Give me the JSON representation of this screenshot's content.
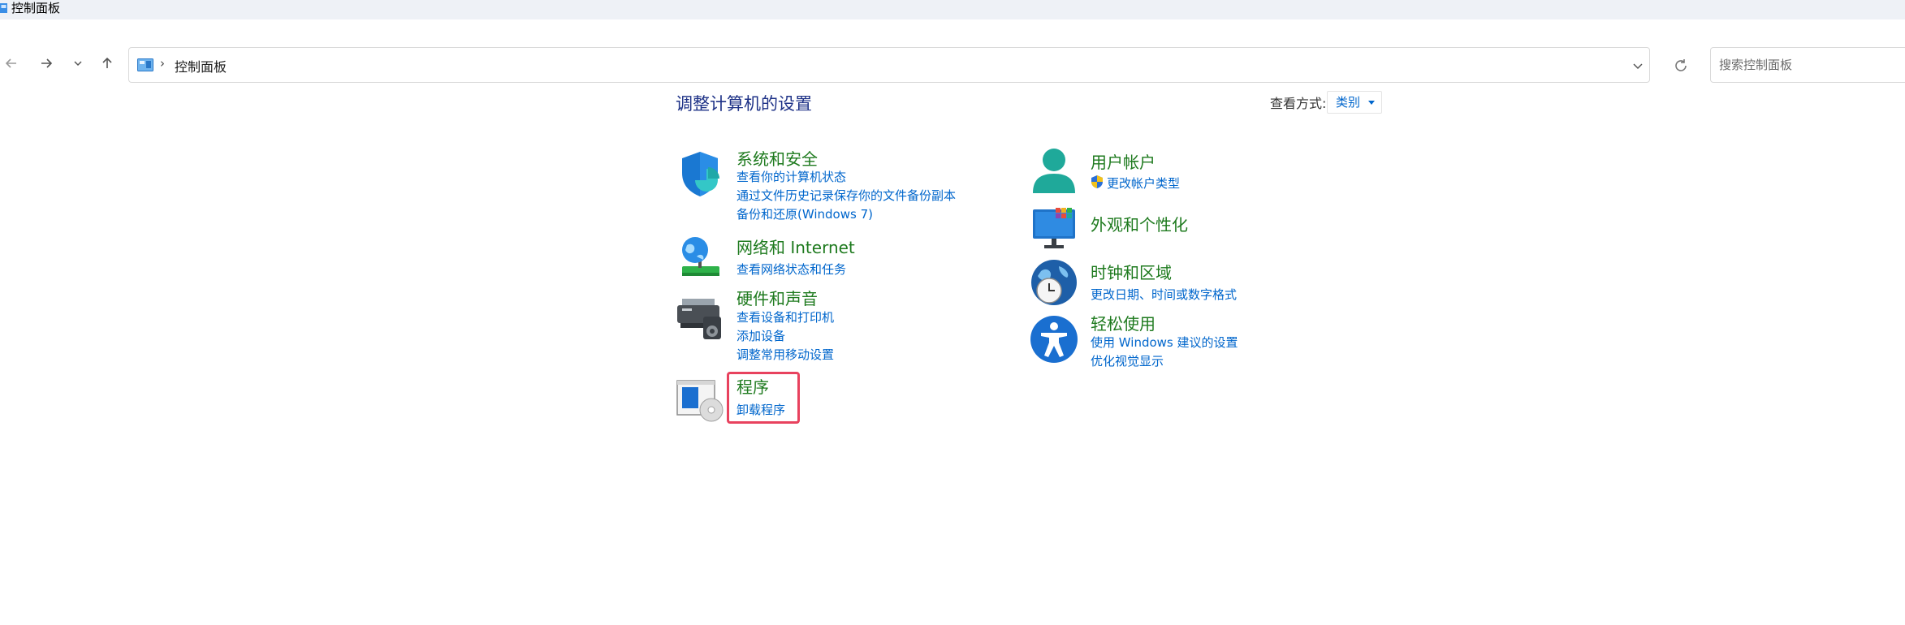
{
  "window": {
    "title": "控制面板"
  },
  "address_bar": {
    "crumb": "控制面板",
    "separator": "›"
  },
  "search": {
    "placeholder": "搜索控制面板"
  },
  "page": {
    "heading": "调整计算机的设置",
    "view_by_label": "查看方式:",
    "view_by_value": "类别"
  },
  "categories": {
    "system_security": {
      "title": "系统和安全",
      "links": [
        "查看你的计算机状态",
        "通过文件历史记录保存你的文件备份副本",
        "备份和还原(Windows 7)"
      ]
    },
    "network_internet": {
      "title": "网络和 Internet",
      "links": [
        "查看网络状态和任务"
      ]
    },
    "hardware_sound": {
      "title": "硬件和声音",
      "links": [
        "查看设备和打印机",
        "添加设备",
        "调整常用移动设置"
      ]
    },
    "programs": {
      "title": "程序",
      "links": [
        "卸载程序"
      ]
    },
    "user_accounts": {
      "title": "用户帐户",
      "links": [
        "更改帐户类型"
      ]
    },
    "appearance": {
      "title": "外观和个性化",
      "links": []
    },
    "clock_region": {
      "title": "时钟和区域",
      "links": [
        "更改日期、时间或数字格式"
      ]
    },
    "ease_of_access": {
      "title": "轻松使用",
      "links": [
        "使用 Windows 建议的设置",
        "优化视觉显示"
      ]
    }
  },
  "colors": {
    "heading": "#1e3287",
    "category_title": "#1e7a1e",
    "link": "#0066cc",
    "highlight_box": "#e8425e"
  }
}
